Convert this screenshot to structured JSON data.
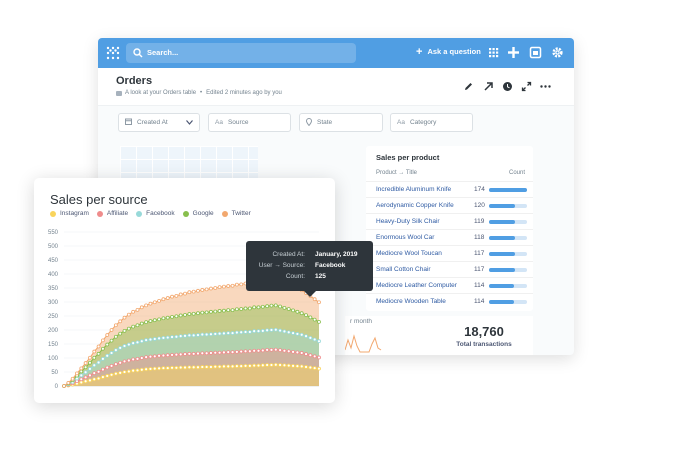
{
  "topbar": {
    "search_placeholder": "Search...",
    "ask_label": "Ask a question",
    "icons": [
      "logo-icon",
      "search-icon",
      "grid-icon",
      "plus-icon",
      "browse-data-icon",
      "gear-icon"
    ]
  },
  "header": {
    "title": "Orders",
    "subtitle": "A look at your Orders table",
    "separator": "•",
    "edited": "Edited 2 minutes ago by you",
    "icons": [
      "pencil-icon",
      "share-arrow-icon",
      "clock-icon",
      "fullscreen-icon",
      "more-icon"
    ]
  },
  "filters": [
    {
      "label": "Created At",
      "icon": "calendar-icon"
    },
    {
      "label": "Source",
      "icon": "text-icon"
    },
    {
      "label": "State",
      "icon": "location-icon"
    },
    {
      "label": "Category",
      "icon": "text-icon"
    }
  ],
  "filter_icons": {
    "text": "Aa"
  },
  "sales_per_product": {
    "title": "Sales per product",
    "col_product": "Product → Title",
    "col_count": "Count",
    "max": 174,
    "rows": [
      {
        "title": "Incredible Aluminum Knife",
        "count": 174
      },
      {
        "title": "Aerodynamic Copper Knife",
        "count": 120
      },
      {
        "title": "Heavy-Duty Silk Chair",
        "count": 119
      },
      {
        "title": "Enormous Wool Car",
        "count": 118
      },
      {
        "title": "Mediocre Wool Toucan",
        "count": 117
      },
      {
        "title": "Small Cotton Chair",
        "count": 117
      },
      {
        "title": "Mediocre Leather Computer",
        "count": 114
      },
      {
        "title": "Mediocre Wooden Table",
        "count": 114
      }
    ]
  },
  "bottom_card": {
    "label_fragment": "r month"
  },
  "total": {
    "value": "18,760",
    "label": "Total transactions"
  },
  "colors": {
    "brand": "#509ee3",
    "instagram": "#f9d45c",
    "affiliate": "#ef8c8c",
    "facebook": "#98d9d9",
    "google": "#88bf4d",
    "twitter": "#f2a86f"
  },
  "chart_data": {
    "type": "area",
    "stacked": true,
    "title": "Sales per source",
    "xlabel": "",
    "ylabel": "",
    "ylim": [
      0,
      550
    ],
    "yticks": [
      0,
      50,
      100,
      150,
      200,
      250,
      300,
      350,
      400,
      450,
      500,
      550
    ],
    "legend_position": "top-left",
    "grid": true,
    "series": [
      {
        "name": "Instagram",
        "color": "#f9d45c",
        "values": [
          0,
          2,
          5,
          9,
          13,
          17,
          20,
          24,
          27,
          32,
          36,
          40,
          44,
          47,
          50,
          52,
          55,
          56,
          58,
          60,
          61,
          62,
          63,
          64,
          64,
          65,
          65,
          66,
          66,
          67,
          67,
          67,
          68,
          68,
          68,
          69,
          69,
          70,
          70,
          70,
          71,
          71,
          72,
          72,
          73,
          73,
          74,
          75,
          75,
          76,
          75,
          74,
          73,
          72,
          71,
          70,
          68,
          66,
          64,
          62
        ]
      },
      {
        "name": "Affiliate",
        "color": "#ef8c8c",
        "values": [
          0,
          2,
          5,
          8,
          11,
          14,
          18,
          22,
          24,
          27,
          30,
          32,
          34,
          36,
          38,
          39,
          40,
          41,
          42,
          43,
          44,
          44,
          45,
          45,
          46,
          46,
          47,
          47,
          48,
          48,
          48,
          49,
          49,
          49,
          50,
          50,
          50,
          50,
          51,
          51,
          51,
          52,
          52,
          52,
          53,
          53,
          53,
          54,
          54,
          54,
          53,
          52,
          51,
          50,
          49,
          48,
          46,
          44,
          42,
          40
        ]
      },
      {
        "name": "Facebook",
        "color": "#98d9d9",
        "values": [
          0,
          2,
          5,
          10,
          14,
          18,
          23,
          28,
          33,
          38,
          42,
          46,
          50,
          53,
          55,
          57,
          58,
          59,
          60,
          61,
          61,
          62,
          62,
          63,
          63,
          64,
          64,
          65,
          65,
          66,
          66,
          66,
          67,
          67,
          67,
          67,
          68,
          68,
          68,
          68,
          69,
          69,
          69,
          69,
          70,
          70,
          70,
          70,
          71,
          71,
          70,
          69,
          68,
          67,
          66,
          65,
          64,
          62,
          60,
          58
        ]
      },
      {
        "name": "Google",
        "color": "#88bf4d",
        "values": [
          0,
          3,
          6,
          10,
          14,
          18,
          22,
          27,
          31,
          36,
          40,
          44,
          48,
          51,
          54,
          57,
          59,
          61,
          63,
          64,
          66,
          67,
          68,
          70,
          71,
          72,
          73,
          74,
          75,
          76,
          77,
          78,
          78,
          79,
          80,
          80,
          81,
          81,
          82,
          82,
          83,
          83,
          84,
          84,
          85,
          85,
          86,
          86,
          87,
          87,
          86,
          84,
          83,
          81,
          79,
          77,
          75,
          73,
          71,
          69
        ]
      },
      {
        "name": "Twitter",
        "color": "#f2a86f",
        "values": [
          0,
          2,
          5,
          8,
          11,
          15,
          18,
          22,
          26,
          30,
          34,
          38,
          41,
          44,
          47,
          50,
          53,
          55,
          58,
          60,
          62,
          64,
          66,
          68,
          70,
          72,
          73,
          75,
          76,
          78,
          79,
          80,
          81,
          82,
          83,
          84,
          85,
          86,
          86,
          87,
          88,
          88,
          89,
          90,
          90,
          91,
          91,
          92,
          92,
          93,
          92,
          91,
          89,
          87,
          85,
          82,
          79,
          76,
          73,
          70
        ]
      }
    ]
  },
  "tooltip": {
    "rows": [
      {
        "key": "Created At:",
        "value": "January, 2019"
      },
      {
        "key": "User → Source:",
        "value": "Facebook"
      },
      {
        "key": "Count:",
        "value": "125"
      }
    ]
  }
}
